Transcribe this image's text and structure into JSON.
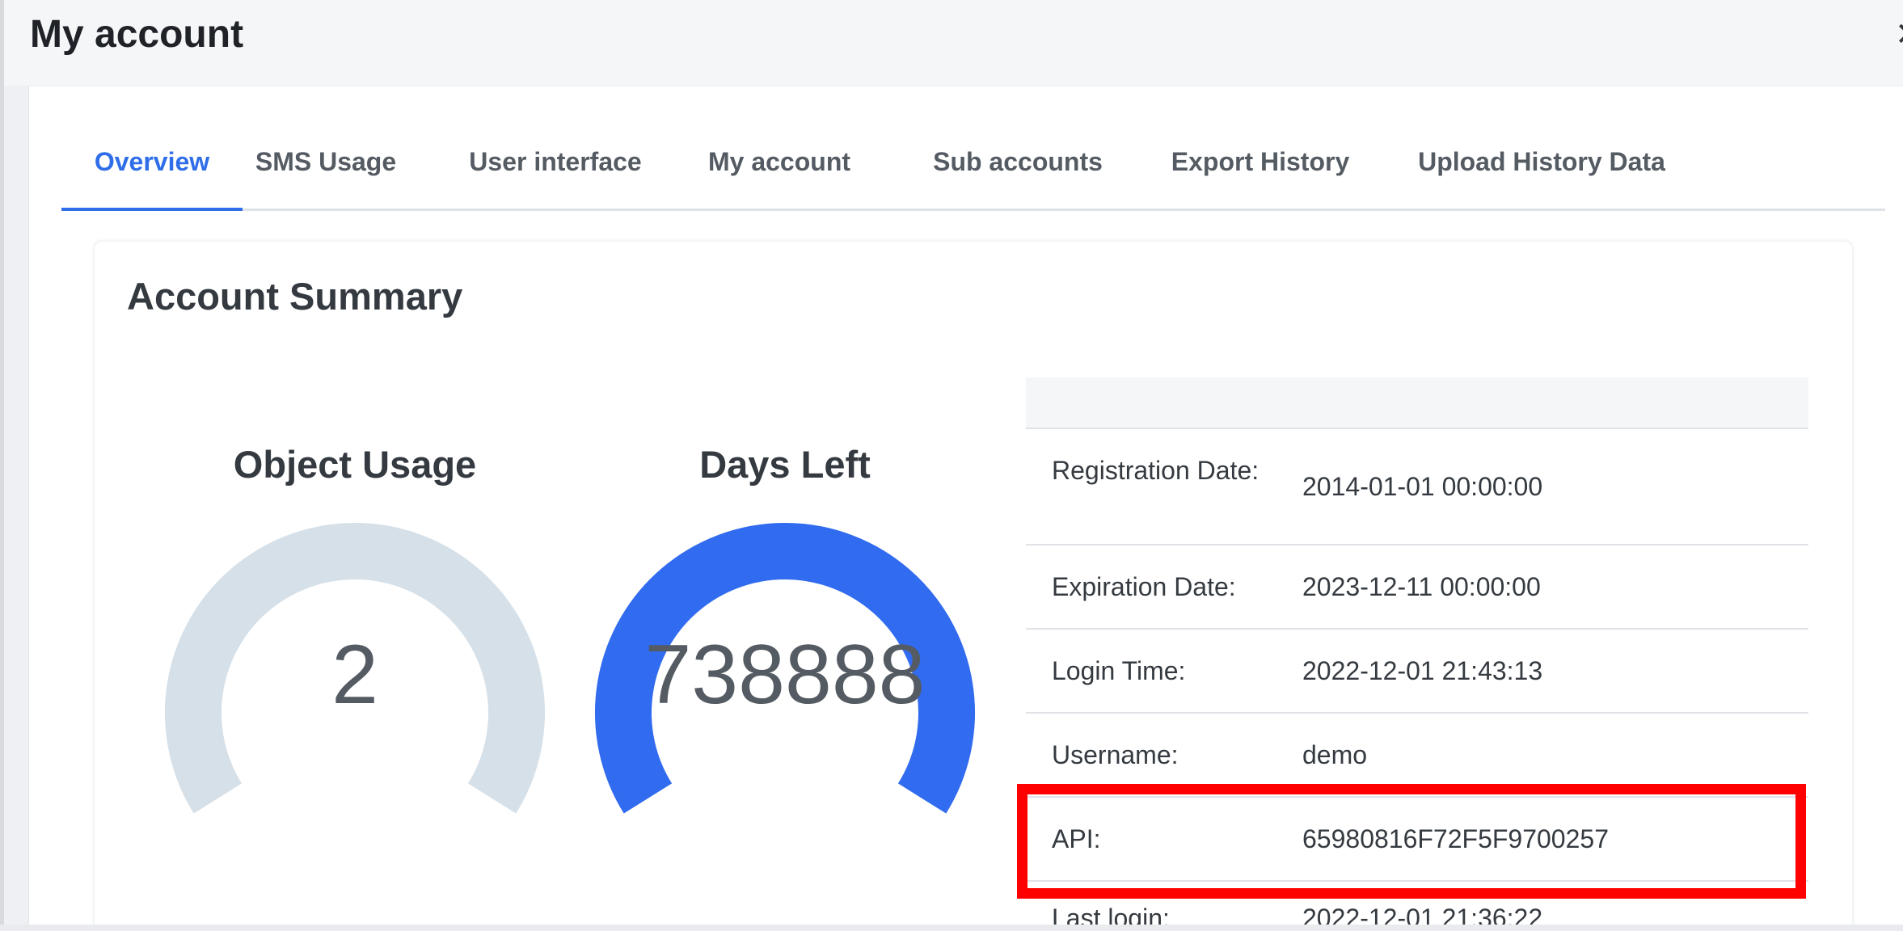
{
  "header": {
    "title": "My account",
    "close_icon": "close-icon"
  },
  "tabs": [
    {
      "label": "Overview",
      "active": true
    },
    {
      "label": "SMS Usage",
      "active": false
    },
    {
      "label": "User interface",
      "active": false
    },
    {
      "label": "My account",
      "active": false
    },
    {
      "label": "Sub accounts",
      "active": false
    },
    {
      "label": "Export History",
      "active": false
    },
    {
      "label": "Upload History Data",
      "active": false
    }
  ],
  "summary": {
    "title": "Account Summary",
    "gauges": [
      {
        "title": "Object Usage",
        "value": "2",
        "fill_fraction": 0.0,
        "color": "#d6e0e8"
      },
      {
        "title": "Days Left",
        "value": "738888",
        "fill_fraction": 1.0,
        "color": "#316bef"
      }
    ],
    "info": [
      {
        "label": "Registration Date:",
        "value": "2014-01-01 00:00:00"
      },
      {
        "label": "Expiration Date:",
        "value": "2023-12-11 00:00:00"
      },
      {
        "label": "Login Time:",
        "value": "2022-12-01 21:43:13"
      },
      {
        "label": "Username:",
        "value": "demo"
      },
      {
        "label": "API:",
        "value": "65980816F72F5F9700257"
      },
      {
        "label": "Last login:",
        "value": "2022-12-01 21:36:22"
      }
    ]
  },
  "colors": {
    "accent": "#2f6ee8",
    "gauge_track": "#d6e0e8",
    "gauge_fill": "#316bef",
    "highlight": "#fe0000"
  }
}
